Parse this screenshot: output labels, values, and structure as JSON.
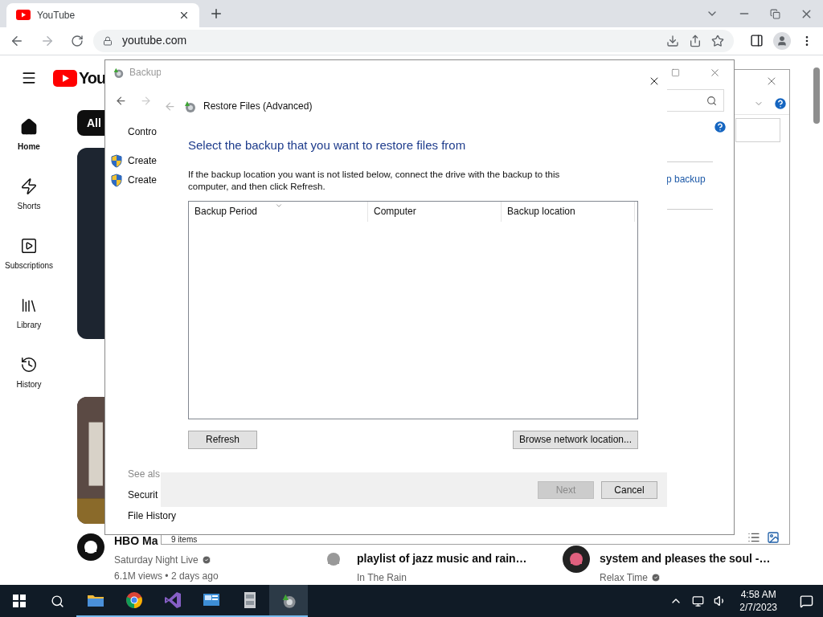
{
  "browser": {
    "tab_title": "YouTube",
    "address": "youtube.com"
  },
  "youtube": {
    "logo": "You",
    "sidebar": [
      {
        "kind": "home",
        "label": "Home",
        "selected": true
      },
      {
        "kind": "shorts",
        "label": "Shorts",
        "selected": false
      },
      {
        "kind": "subscriptions",
        "label": "Subscriptions",
        "selected": false
      },
      {
        "kind": "library",
        "label": "Library",
        "selected": false
      },
      {
        "kind": "history",
        "label": "History",
        "selected": false
      }
    ],
    "chips": [
      {
        "label": "All",
        "selected": true
      }
    ],
    "videos": [
      {
        "title": "HBO Ma",
        "channel": "Saturday Night Live",
        "verified": true,
        "meta": "6.1M views • 2 days ago"
      },
      {
        "title": "playlist of jazz music and rain…",
        "channel": "In The Rain",
        "verified": false
      },
      {
        "title": "system and pleases the soul -…",
        "channel": "Relax Time",
        "verified": true
      }
    ]
  },
  "explorer": {
    "status": "9 items"
  },
  "backup_window": {
    "title": "Backup",
    "left_pane": [
      {
        "kind": "link",
        "label": "Contro"
      },
      {
        "kind": "shield",
        "label": "Create"
      },
      {
        "kind": "shield",
        "label": "Create"
      }
    ],
    "see_also": {
      "heading": "See als",
      "links": [
        "Securit",
        "File History"
      ]
    },
    "link": "p backup"
  },
  "dialog": {
    "title": "Restore Files (Advanced)",
    "heading": "Select the backup that you want to restore files from",
    "instructions": "If the backup location you want is not listed below, connect the drive with the backup to this computer, and then click Refresh.",
    "columns": [
      {
        "label": "Backup Period",
        "sorted": true
      },
      {
        "label": "Computer",
        "sorted": false
      },
      {
        "label": "Backup location",
        "sorted": false
      }
    ],
    "refresh": "Refresh",
    "browse": "Browse network location...",
    "next": {
      "label": "Next",
      "disabled": true
    },
    "cancel": {
      "label": "Cancel",
      "disabled": false
    }
  },
  "taskbar": {
    "apps": [
      {
        "kind": "folder",
        "selected": false
      },
      {
        "kind": "chrome",
        "selected": false
      },
      {
        "kind": "studio",
        "selected": false
      },
      {
        "kind": "panel",
        "selected": false
      },
      {
        "kind": "cabinet",
        "selected": false
      },
      {
        "kind": "backup",
        "selected": true
      }
    ],
    "time": "4:58 AM",
    "date": "2/7/2023"
  }
}
